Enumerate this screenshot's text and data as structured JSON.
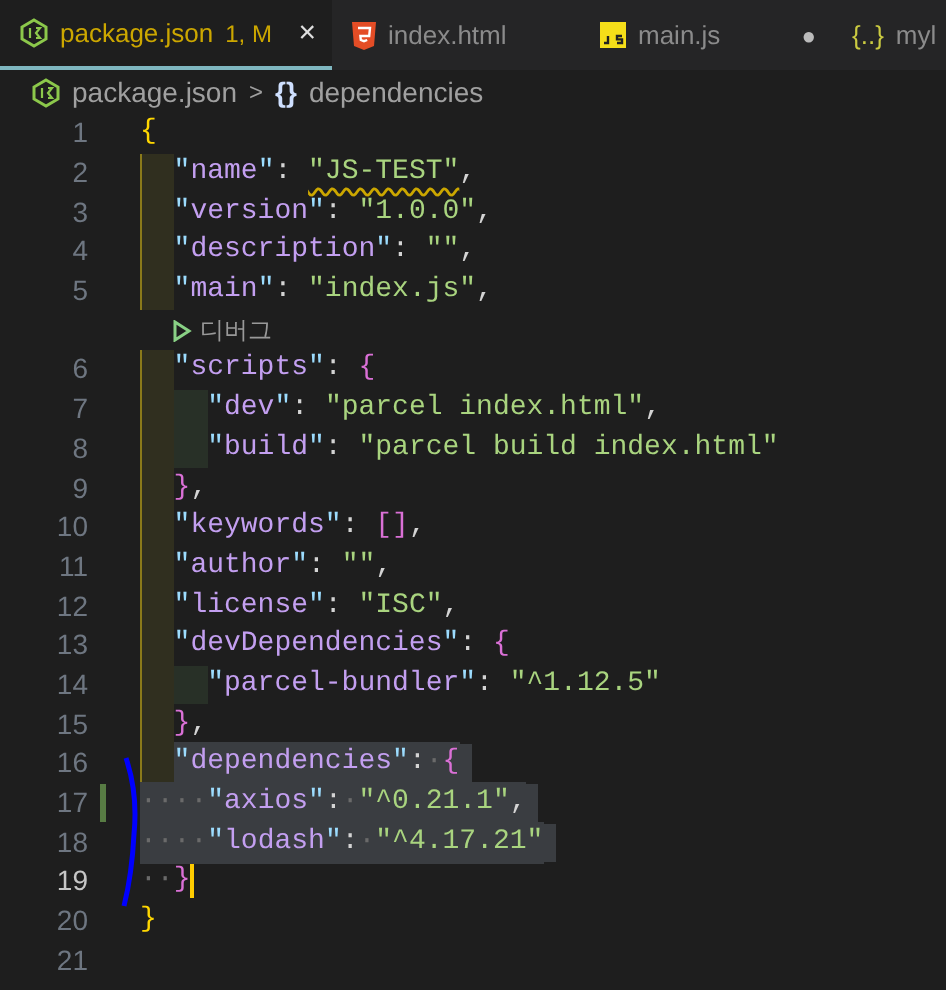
{
  "tabs": [
    {
      "kind": "node",
      "label": "package.json",
      "badge": "1, M",
      "selected": true,
      "close": "×"
    },
    {
      "kind": "html",
      "label": "index.html",
      "selected": false
    },
    {
      "kind": "js",
      "label": "main.js",
      "selected": false,
      "dirty_mark": "●"
    },
    {
      "kind": "braces",
      "icon_text": "{..}",
      "label": "myl",
      "selected": false
    }
  ],
  "breadcrumb": {
    "file": "package.json",
    "separator": ">",
    "symbol": "{}",
    "item": "dependencies"
  },
  "editor": {
    "lines": [
      {
        "kind": "code",
        "number": "1",
        "selected": false,
        "active": false,
        "changed": false,
        "tokens": [
          {
            "kind": "brace1",
            "text": "{"
          }
        ]
      },
      {
        "kind": "code",
        "number": "2",
        "selected": false,
        "active": false,
        "changed": false,
        "tokens": [
          {
            "kind": "indent"
          },
          {
            "kind": "key",
            "text": "\"name\""
          },
          {
            "kind": "punct",
            "text": ": "
          },
          {
            "kind": "string",
            "text": "\"JS-TEST\"",
            "squiggle": true
          },
          {
            "kind": "punct",
            "text": ","
          }
        ]
      },
      {
        "kind": "code",
        "number": "3",
        "selected": false,
        "active": false,
        "changed": false,
        "tokens": [
          {
            "kind": "indent"
          },
          {
            "kind": "key",
            "text": "\"version\""
          },
          {
            "kind": "punct",
            "text": ": "
          },
          {
            "kind": "string",
            "text": "\"1.0.0\""
          },
          {
            "kind": "punct",
            "text": ","
          }
        ]
      },
      {
        "kind": "code",
        "number": "4",
        "selected": false,
        "active": false,
        "changed": false,
        "tokens": [
          {
            "kind": "indent"
          },
          {
            "kind": "key",
            "text": "\"description\""
          },
          {
            "kind": "punct",
            "text": ": "
          },
          {
            "kind": "string",
            "text": "\"\""
          },
          {
            "kind": "punct",
            "text": ","
          }
        ]
      },
      {
        "kind": "code",
        "number": "5",
        "selected": false,
        "active": false,
        "changed": false,
        "tokens": [
          {
            "kind": "indent"
          },
          {
            "kind": "key",
            "text": "\"main\""
          },
          {
            "kind": "punct",
            "text": ": "
          },
          {
            "kind": "string",
            "text": "\"index.js\""
          },
          {
            "kind": "punct",
            "text": ","
          }
        ]
      },
      {
        "kind": "codelens",
        "label": "디버그"
      },
      {
        "kind": "code",
        "number": "6",
        "selected": false,
        "active": false,
        "changed": false,
        "tokens": [
          {
            "kind": "indent"
          },
          {
            "kind": "key",
            "text": "\"scripts\""
          },
          {
            "kind": "punct",
            "text": ": "
          },
          {
            "kind": "brace2",
            "text": "{"
          }
        ]
      },
      {
        "kind": "code",
        "number": "7",
        "selected": false,
        "active": false,
        "changed": false,
        "tokens": [
          {
            "kind": "indent"
          },
          {
            "kind": "indent"
          },
          {
            "kind": "key",
            "text": "\"dev\""
          },
          {
            "kind": "punct",
            "text": ": "
          },
          {
            "kind": "string",
            "text": "\"parcel index.html\""
          },
          {
            "kind": "punct",
            "text": ","
          }
        ]
      },
      {
        "kind": "code",
        "number": "8",
        "selected": false,
        "active": false,
        "changed": false,
        "tokens": [
          {
            "kind": "indent"
          },
          {
            "kind": "indent"
          },
          {
            "kind": "key",
            "text": "\"build\""
          },
          {
            "kind": "punct",
            "text": ": "
          },
          {
            "kind": "string",
            "text": "\"parcel build index.html\""
          }
        ]
      },
      {
        "kind": "code",
        "number": "9",
        "selected": false,
        "active": false,
        "changed": false,
        "tokens": [
          {
            "kind": "indent"
          },
          {
            "kind": "brace2",
            "text": "}"
          },
          {
            "kind": "punct",
            "text": ","
          }
        ]
      },
      {
        "kind": "code",
        "number": "10",
        "selected": false,
        "active": false,
        "changed": false,
        "tokens": [
          {
            "kind": "indent"
          },
          {
            "kind": "key",
            "text": "\"keywords\""
          },
          {
            "kind": "punct",
            "text": ": "
          },
          {
            "kind": "brace2",
            "text": "[]"
          },
          {
            "kind": "punct",
            "text": ","
          }
        ]
      },
      {
        "kind": "code",
        "number": "11",
        "selected": false,
        "active": false,
        "changed": false,
        "tokens": [
          {
            "kind": "indent"
          },
          {
            "kind": "key",
            "text": "\"author\""
          },
          {
            "kind": "punct",
            "text": ": "
          },
          {
            "kind": "string",
            "text": "\"\""
          },
          {
            "kind": "punct",
            "text": ","
          }
        ]
      },
      {
        "kind": "code",
        "number": "12",
        "selected": false,
        "active": false,
        "changed": false,
        "tokens": [
          {
            "kind": "indent"
          },
          {
            "kind": "key",
            "text": "\"license\""
          },
          {
            "kind": "punct",
            "text": ": "
          },
          {
            "kind": "string",
            "text": "\"ISC\""
          },
          {
            "kind": "punct",
            "text": ","
          }
        ]
      },
      {
        "kind": "code",
        "number": "13",
        "selected": false,
        "active": false,
        "changed": false,
        "tokens": [
          {
            "kind": "indent"
          },
          {
            "kind": "key",
            "text": "\"devDependencies\""
          },
          {
            "kind": "punct",
            "text": ": "
          },
          {
            "kind": "brace2",
            "text": "{"
          }
        ]
      },
      {
        "kind": "code",
        "number": "14",
        "selected": false,
        "active": false,
        "changed": false,
        "tokens": [
          {
            "kind": "indent"
          },
          {
            "kind": "indent"
          },
          {
            "kind": "key",
            "text": "\"parcel-bundler\""
          },
          {
            "kind": "punct",
            "text": ": "
          },
          {
            "kind": "string",
            "text": "\"^1.12.5\""
          }
        ]
      },
      {
        "kind": "code",
        "number": "15",
        "selected": false,
        "active": false,
        "changed": false,
        "tokens": [
          {
            "kind": "indent"
          },
          {
            "kind": "brace2",
            "text": "}"
          },
          {
            "kind": "punct",
            "text": ","
          }
        ]
      },
      {
        "kind": "code",
        "number": "16",
        "selected": true,
        "active": false,
        "changed": false,
        "tokens": [
          {
            "kind": "indent"
          },
          {
            "kind": "key",
            "text": "\"dependencies\""
          },
          {
            "kind": "punct",
            "text": ":"
          },
          {
            "kind": "ws",
            "text": "·"
          },
          {
            "kind": "brace2",
            "text": "{"
          }
        ]
      },
      {
        "kind": "code",
        "number": "17",
        "selected": true,
        "active": false,
        "changed": true,
        "tokens": [
          {
            "kind": "ws",
            "text": "····"
          },
          {
            "kind": "key",
            "text": "\"axios\""
          },
          {
            "kind": "punct",
            "text": ":"
          },
          {
            "kind": "ws",
            "text": "·"
          },
          {
            "kind": "string",
            "text": "\"^0.21.1\""
          },
          {
            "kind": "punct",
            "text": ","
          }
        ]
      },
      {
        "kind": "code",
        "number": "18",
        "selected": true,
        "active": false,
        "changed": false,
        "tokens": [
          {
            "kind": "ws",
            "text": "····"
          },
          {
            "kind": "key",
            "text": "\"lodash\""
          },
          {
            "kind": "punct",
            "text": ":"
          },
          {
            "kind": "ws",
            "text": "·"
          },
          {
            "kind": "string",
            "text": "\"^4.17.21\""
          }
        ]
      },
      {
        "kind": "code",
        "number": "19",
        "selected": false,
        "active": true,
        "changed": false,
        "tokens": [
          {
            "kind": "ws",
            "text": "··"
          },
          {
            "kind": "brace2",
            "text": "}"
          }
        ]
      },
      {
        "kind": "code",
        "number": "20",
        "selected": false,
        "active": false,
        "changed": false,
        "tokens": [
          {
            "kind": "brace1",
            "text": "}"
          }
        ]
      },
      {
        "kind": "code",
        "number": "21",
        "active": false,
        "changed": false
      }
    ]
  }
}
